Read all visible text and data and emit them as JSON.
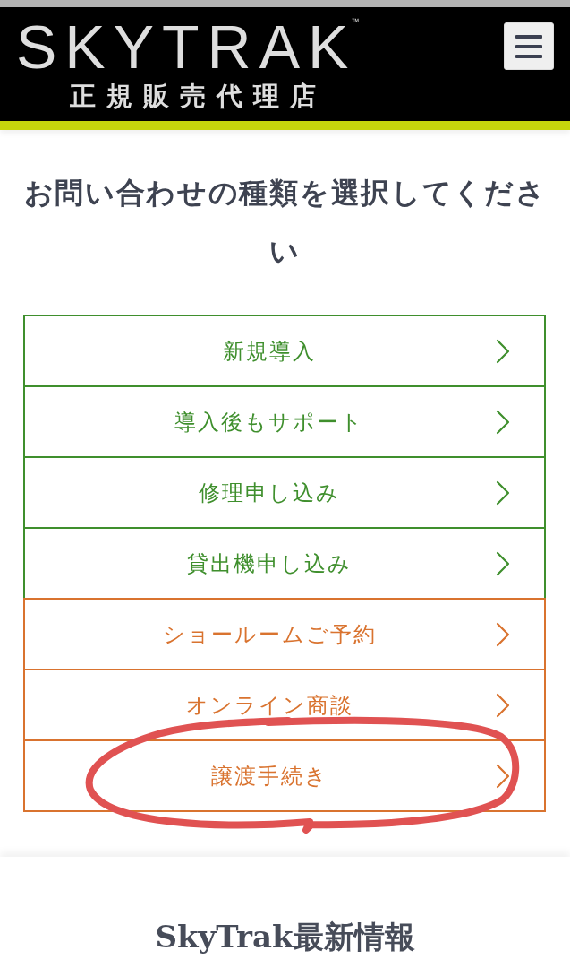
{
  "header": {
    "logo": "SKYTRAK$^{™}$",
    "subtitle": "正規販売代理店"
  },
  "heading": "お問い合わせの種類を選択してください",
  "items": [
    {
      "label": "新規導入",
      "color": "#3f8f2d",
      "circled": false
    },
    {
      "label": "導入後もサポート",
      "color": "#3f8f2d",
      "circled": false
    },
    {
      "label": "修理申し込み",
      "color": "#3f8f2d",
      "circled": false
    },
    {
      "label": "貸出機申し込み",
      "color": "#3f8f2d",
      "circled": false
    },
    {
      "label": "ショールームご予約",
      "color": "#d9732f",
      "circled": false
    },
    {
      "label": "オンライン商談",
      "color": "#d9732f",
      "circled": false
    },
    {
      "label": "譲渡手続き",
      "color": "#d9732f",
      "circled": true
    }
  ],
  "news_heading": "SkyTrak最新情報"
}
